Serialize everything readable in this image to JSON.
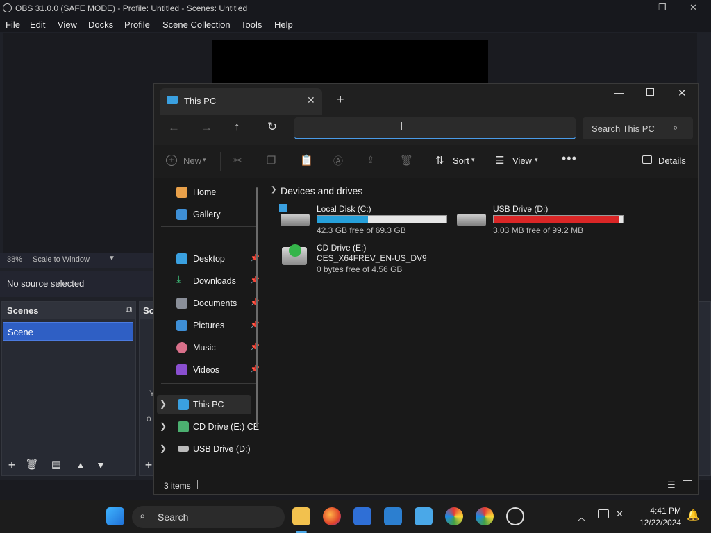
{
  "obs": {
    "title": "OBS 31.0.0 (SAFE MODE) - Profile: Untitled - Scenes: Untitled",
    "menu": [
      "File",
      "Edit",
      "View",
      "Docks",
      "Profile",
      "Scene Collection",
      "Tools",
      "Help"
    ],
    "zoom": "38%",
    "scale_mode": "Scale to Window",
    "no_source": "No source selected",
    "scenes_header": "Scenes",
    "sources_header_partial": "So",
    "scene_item": "Scene",
    "sources_partial_text": [
      "Y",
      "o"
    ]
  },
  "explorer": {
    "tab_title": "This PC",
    "search_placeholder": "Search This PC",
    "toolbar": {
      "new": "New",
      "sort": "Sort",
      "view": "View",
      "details": "Details"
    },
    "nav": {
      "top": [
        {
          "label": "Home",
          "icon": "home-icon"
        },
        {
          "label": "Gallery",
          "icon": "gallery-icon"
        }
      ],
      "pinned": [
        {
          "label": "Desktop",
          "icon": "desktop-icon"
        },
        {
          "label": "Downloads",
          "icon": "downloads-icon"
        },
        {
          "label": "Documents",
          "icon": "documents-icon"
        },
        {
          "label": "Pictures",
          "icon": "pictures-icon"
        },
        {
          "label": "Music",
          "icon": "music-icon"
        },
        {
          "label": "Videos",
          "icon": "videos-icon"
        }
      ],
      "tree": [
        {
          "label": "This PC",
          "icon": "computer-icon"
        },
        {
          "label": "CD Drive (E:) CE",
          "icon": "cd-drive-icon"
        },
        {
          "label": "USB Drive (D:)",
          "icon": "usb-drive-icon"
        }
      ]
    },
    "section": "Devices and drives",
    "drives": [
      {
        "name": "Local Disk (C:)",
        "free": "42.3 GB free of 69.3 GB",
        "used_fraction": 0.39,
        "bar_color": "#26a0da"
      },
      {
        "name": "USB Drive (D:)",
        "free": "3.03 MB free of 99.2 MB",
        "used_fraction": 0.97,
        "bar_color": "#da2626"
      },
      {
        "name": "CD Drive (E:)",
        "label": "CES_X64FREV_EN-US_DV9",
        "free": "0 bytes free of 4.56 GB"
      }
    ],
    "status": "3 items"
  },
  "taskbar": {
    "search": "Search",
    "time": "4:41 PM",
    "date": "12/22/2024"
  }
}
